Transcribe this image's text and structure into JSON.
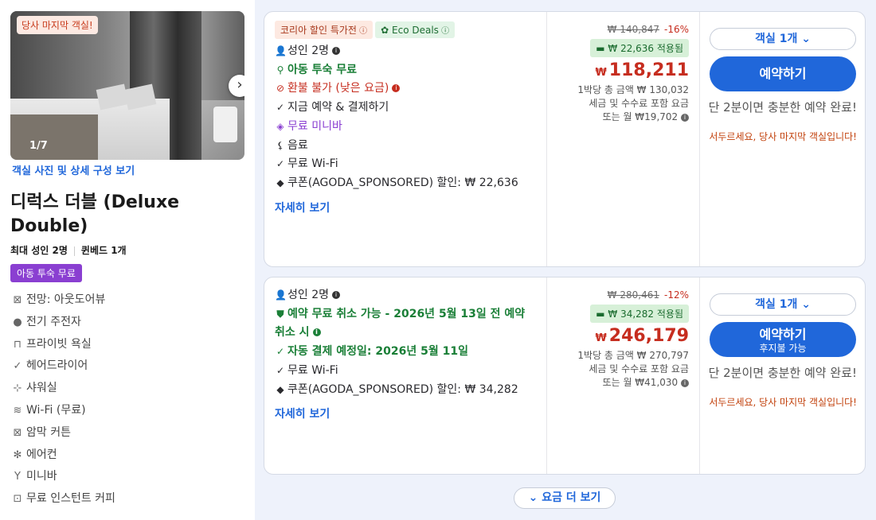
{
  "room": {
    "last_room_badge": "당사 마지막 객실!",
    "photo_counter": "1/7",
    "photo_link": "객실 사진 및 상세 구성 보기",
    "title": "디럭스 더블 (Deluxe Double)",
    "max_guests": "최대 성인 2명",
    "bed": "퀸베드 1개",
    "kids_badge": "아동 투숙 무료",
    "amenities": [
      {
        "icon": "view-icon",
        "glyph": "⊠",
        "label": "전망: 아웃도어뷰"
      },
      {
        "icon": "electric-kettle-icon",
        "glyph": "●",
        "label": "전기 주전자"
      },
      {
        "icon": "bathtub-icon",
        "glyph": "⊓",
        "label": "프라이빗 욕실"
      },
      {
        "icon": "check-icon",
        "glyph": "✓",
        "label": "헤어드라이어"
      },
      {
        "icon": "shower-icon",
        "glyph": "⊹",
        "label": "샤워실"
      },
      {
        "icon": "wifi-icon",
        "glyph": "≋",
        "label": "Wi-Fi (무료)"
      },
      {
        "icon": "curtain-icon",
        "glyph": "⊠",
        "label": "암막 커튼"
      },
      {
        "icon": "aircon-icon",
        "glyph": "✻",
        "label": "에어컨"
      },
      {
        "icon": "minibar-icon",
        "glyph": "Y",
        "label": "미니바"
      },
      {
        "icon": "coffee-icon",
        "glyph": "⊡",
        "label": "무료 인스턴트 커피"
      }
    ]
  },
  "offers": [
    {
      "tags": [
        {
          "label": "코리아 할인 특가전",
          "type": "sale"
        },
        {
          "label": "Eco Deals",
          "type": "eco"
        }
      ],
      "features": [
        {
          "icon": "person-icon",
          "glyph": "👤",
          "text": "성인 2명",
          "style": "normal",
          "info": "dark"
        },
        {
          "icon": "child-icon",
          "glyph": "⚲",
          "text": "아동 투숙 무료",
          "style": "greenb",
          "info": ""
        },
        {
          "icon": "no-refund-icon",
          "glyph": "⊘",
          "text": "환불 불가 (낮은 요금)",
          "style": "red",
          "info": "red"
        },
        {
          "icon": "check-icon",
          "glyph": "✓",
          "text": "지금 예약 & 결제하기",
          "style": "normal",
          "info": ""
        },
        {
          "icon": "gem-icon",
          "glyph": "◈",
          "text": "무료 미니바",
          "style": "purple",
          "info": ""
        },
        {
          "icon": "drink-icon",
          "glyph": "⚸",
          "text": "음료",
          "style": "normal",
          "info": ""
        },
        {
          "icon": "check-icon",
          "glyph": "✓",
          "text": "무료 Wi-Fi",
          "style": "normal",
          "info": ""
        },
        {
          "icon": "coupon-icon",
          "glyph": "◆",
          "text": "쿠폰(AGODA_SPONSORED) 할인: ₩ 22,636",
          "style": "normal",
          "info": ""
        }
      ],
      "more": "자세히 보기",
      "original_price": "₩ 140,847",
      "discount_pct": "-16%",
      "coupon_applied": "₩ 22,636 적용됨",
      "currency": "₩",
      "price": "118,211",
      "total_line": "1박당 총 금액 ₩ 130,032",
      "tax_line": "세금 및 수수료 포함 요금",
      "monthly_line": "또는 월 ₩19,702",
      "rooms_select": "객실 1개",
      "book_label": "예약하기",
      "book_sub": "",
      "urgency": "단 2분이면 충분한 예약 완료!",
      "hurry": "서두르세요, 당사 마지막 객실입니다!"
    },
    {
      "tags": [],
      "features": [
        {
          "icon": "person-icon",
          "glyph": "👤",
          "text": "성인 2명",
          "style": "normal",
          "info": "dark"
        },
        {
          "icon": "shield-check-icon",
          "glyph": "⛊",
          "text": "예약 무료 취소 가능 - 2026년 5월 13일 전 예약 취소 시",
          "style": "greenb",
          "info": "green"
        },
        {
          "icon": "check-icon",
          "glyph": "✓",
          "text": "자동 결제 예정일: 2026년 5월 11일",
          "style": "greenb",
          "info": ""
        },
        {
          "icon": "check-icon",
          "glyph": "✓",
          "text": "무료 Wi-Fi",
          "style": "normal",
          "info": ""
        },
        {
          "icon": "coupon-icon",
          "glyph": "◆",
          "text": "쿠폰(AGODA_SPONSORED) 할인: ₩ 34,282",
          "style": "normal",
          "info": ""
        }
      ],
      "more": "자세히 보기",
      "original_price": "₩ 280,461",
      "discount_pct": "-12%",
      "coupon_applied": "₩ 34,282 적용됨",
      "currency": "₩",
      "price": "246,179",
      "total_line": "1박당 총 금액 ₩ 270,797",
      "tax_line": "세금 및 수수료 포함 요금",
      "monthly_line": "또는 월 ₩41,030",
      "rooms_select": "객실 1개",
      "book_label": "예약하기",
      "book_sub": "후지불 가능",
      "urgency": "단 2분이면 충분한 예약 완료!",
      "hurry": "서두르세요, 당사 마지막 객실입니다!"
    }
  ],
  "more_rates": "요금 더 보기",
  "colors": {
    "primary": "#2067da",
    "price_red": "#c62d1f",
    "green": "#1a7f37",
    "purple": "#8a3fd1",
    "panel_bg": "#eef2fb"
  }
}
